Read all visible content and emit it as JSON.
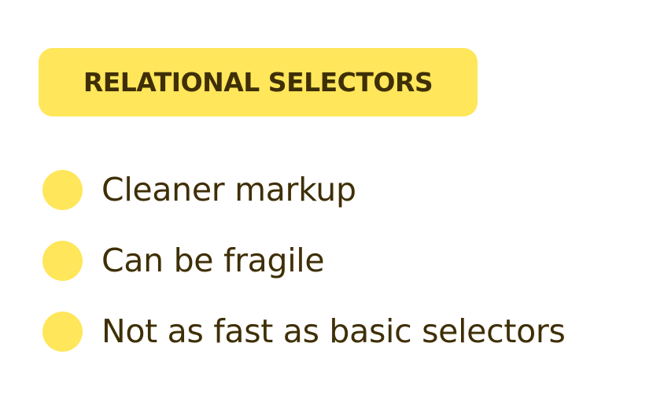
{
  "badge": {
    "label": "RELATIONAL SELECTORS"
  },
  "items": [
    {
      "label": "Cleaner markup"
    },
    {
      "label": "Can be fragile"
    },
    {
      "label": "Not as fast as basic selectors"
    }
  ],
  "colors": {
    "accent": "#ffe65a",
    "text": "#3f2f06",
    "background": "#ffffff"
  },
  "icons": {
    "bullet": "yellow-circle-icon"
  }
}
